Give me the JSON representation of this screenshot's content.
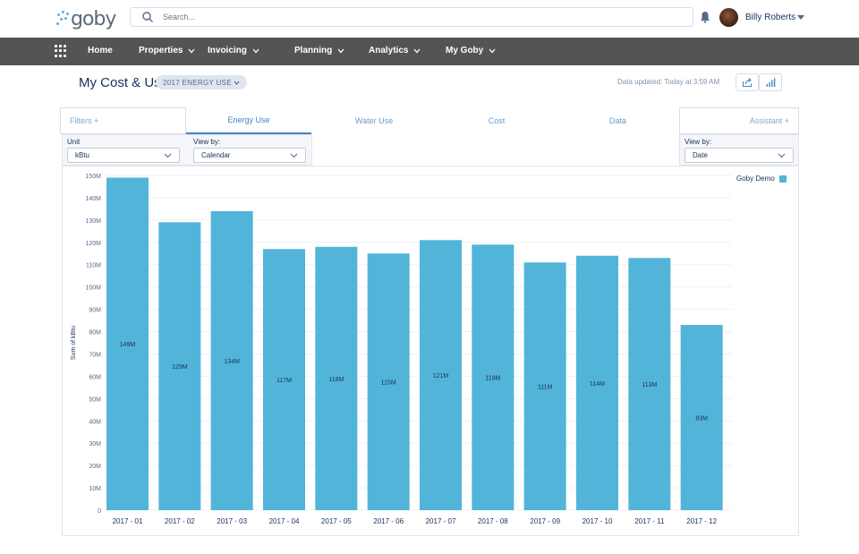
{
  "app": {
    "logo_text": "goby"
  },
  "search": {
    "placeholder": "Search..."
  },
  "user": {
    "name": "Billy Roberts"
  },
  "nav": {
    "items": [
      {
        "label": "Home",
        "has_menu": false
      },
      {
        "label": "Properties",
        "has_menu": true
      },
      {
        "label": "Invoicing",
        "has_menu": true
      },
      {
        "label": "Planning",
        "has_menu": true
      },
      {
        "label": "Analytics",
        "has_menu": true
      },
      {
        "label": "My Goby",
        "has_menu": true
      }
    ]
  },
  "page": {
    "title": "My Cost & Use",
    "badge": "2017 ENERGY USE",
    "updated": "Data updated: Today at 3:59 AM"
  },
  "tabs": {
    "filters": "Filters +",
    "items": [
      "Energy Use",
      "Water Use",
      "Cost",
      "Data"
    ],
    "active": "Energy Use",
    "assistant": "Assistant +"
  },
  "controls": {
    "unit_label": "Unit",
    "unit_value": "kBtu",
    "view_by_label": "View by:",
    "view_by_value": "Calendar",
    "right_view_by_label": "View by:",
    "right_view_by_value": "Date"
  },
  "colors": {
    "bar": "#52b4d9",
    "nav_bg": "#545454",
    "accent": "#3d86c6"
  },
  "chart_data": {
    "type": "bar",
    "ylabel": "Sum of kBtu",
    "xlabel": "",
    "ylim": [
      0,
      150
    ],
    "y_ticks": [
      "0",
      "10M",
      "20M",
      "30M",
      "40M",
      "50M",
      "60M",
      "70M",
      "80M",
      "90M",
      "100M",
      "110M",
      "120M",
      "130M",
      "140M",
      "150M"
    ],
    "categories": [
      "2017 - 01",
      "2017 - 02",
      "2017 - 03",
      "2017 - 04",
      "2017 - 05",
      "2017 - 06",
      "2017 - 07",
      "2017 - 08",
      "2017 - 09",
      "2017 - 10",
      "2017 - 11",
      "2017 - 12"
    ],
    "series": [
      {
        "name": "Goby Demo",
        "values": [
          149,
          129,
          134,
          117,
          118,
          115,
          121,
          119,
          111,
          114,
          113,
          83
        ],
        "labels": [
          "149M",
          "129M",
          "134M",
          "117M",
          "118M",
          "115M",
          "121M",
          "119M",
          "111M",
          "114M",
          "113M",
          "83M"
        ]
      }
    ],
    "legend": "top-right"
  }
}
